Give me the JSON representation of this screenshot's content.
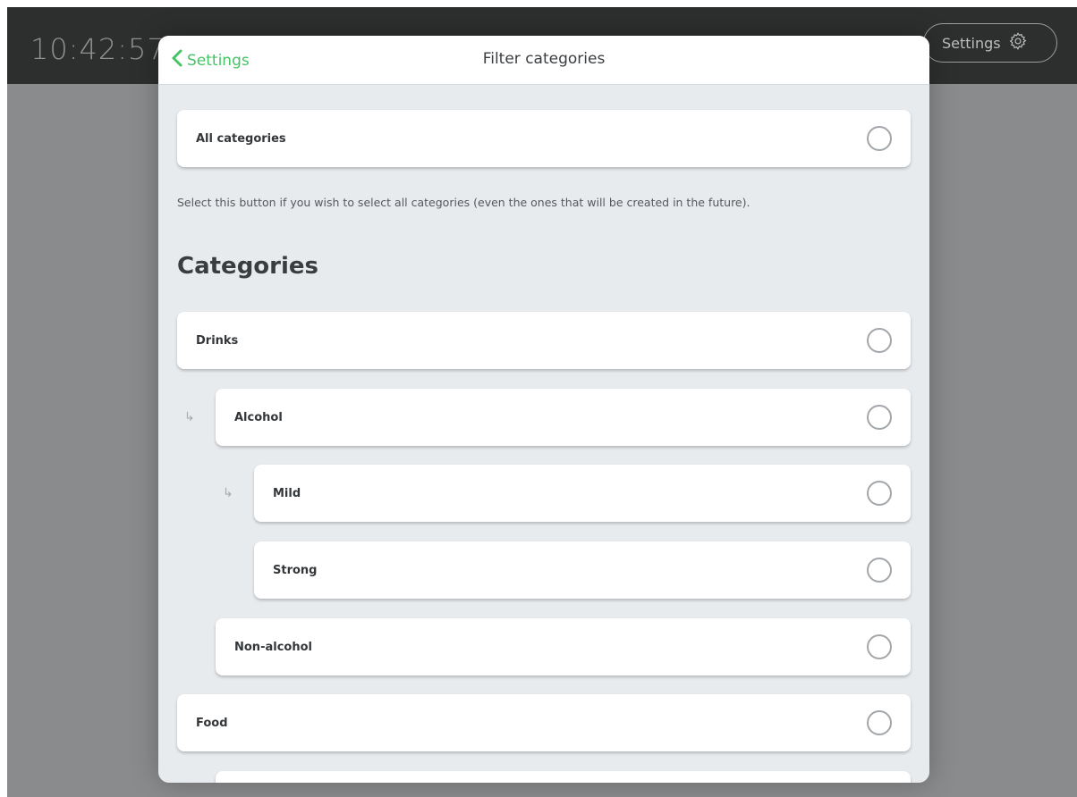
{
  "topbar": {
    "clock": "10:42:57",
    "settings_label": "Settings",
    "settings_icon": "gear-icon"
  },
  "modal": {
    "back_label": "Settings",
    "back_icon": "chevron-left-icon",
    "title": "Filter categories",
    "all_categories": {
      "label": "All categories",
      "selected": false
    },
    "description": "Select this button if you wish to select all categories (even the ones that will be created in the future).",
    "section_title": "Categories",
    "categories": [
      {
        "label": "Drinks",
        "level": 0,
        "selected": false
      },
      {
        "label": "Alcohol",
        "level": 1,
        "selected": false
      },
      {
        "label": "Mild",
        "level": 2,
        "selected": false
      },
      {
        "label": "Strong",
        "level": 2,
        "selected": false
      },
      {
        "label": "Non-alcohol",
        "level": 1,
        "selected": false
      },
      {
        "label": "Food",
        "level": 0,
        "selected": false
      },
      {
        "label": "",
        "level": 1,
        "selected": false
      }
    ]
  },
  "colors": {
    "accent": "#45c466",
    "topbar": "#2d2e2e",
    "backdrop": "#8a8b8c",
    "modal_bg": "#e8ebee"
  }
}
